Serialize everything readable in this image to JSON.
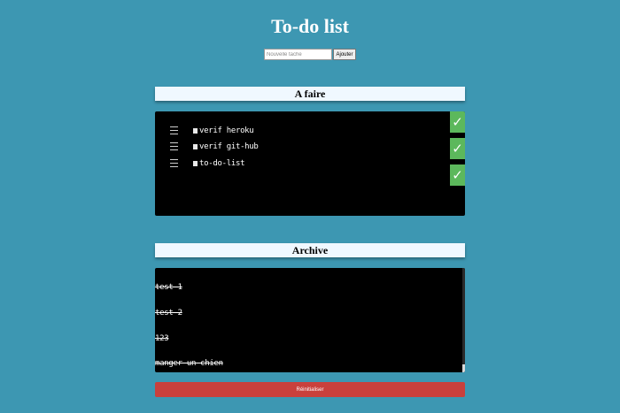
{
  "app": {
    "title": "To-do list"
  },
  "add_form": {
    "input_placeholder": "Nouvelle tache",
    "input_value": "",
    "add_label": "Ajouter"
  },
  "todo": {
    "header": "A faire",
    "items": [
      {
        "label": "verif heroku",
        "check_icon": "✓"
      },
      {
        "label": "verif git-hub",
        "check_icon": "✓"
      },
      {
        "label": "to-do-list",
        "check_icon": "✓"
      }
    ]
  },
  "archive": {
    "header": "Archive",
    "items": [
      {
        "label": "test 1"
      },
      {
        "label": "test 2"
      },
      {
        "label": "123"
      },
      {
        "label": "manger un chien"
      }
    ]
  },
  "reset": {
    "label": "Réinitialiser"
  },
  "colors": {
    "background": "#3d97b2",
    "header_bg": "#f0f8ff",
    "panel_bg": "#000000",
    "check_green": "#5cb85c",
    "reset_red": "#c9403c"
  },
  "icons": {
    "drag": "drag-handle-icon",
    "checkbox": "checkbox-icon",
    "check": "check-icon"
  }
}
